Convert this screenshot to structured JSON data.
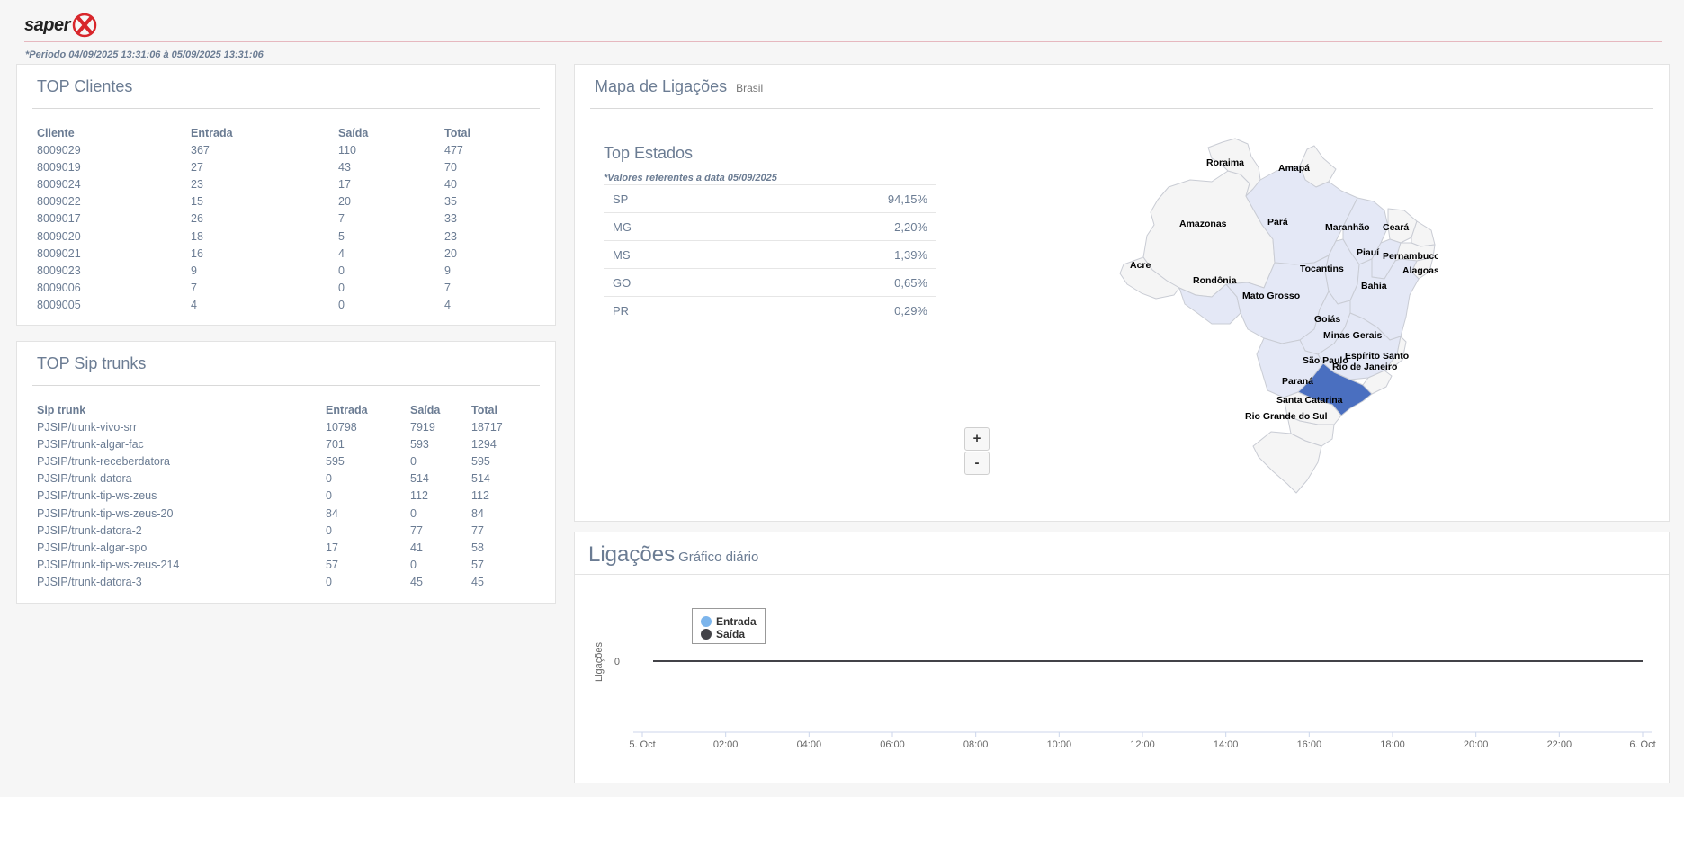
{
  "brand": {
    "name": "saper"
  },
  "period": "*Periodo 04/09/2025 13:31:06 à 05/09/2025 13:31:06",
  "top_clientes": {
    "title": "TOP Clientes",
    "headers": [
      "Cliente",
      "Entrada",
      "Saída",
      "Total"
    ],
    "rows": [
      [
        "8009029",
        "367",
        "110",
        "477"
      ],
      [
        "8009019",
        "27",
        "43",
        "70"
      ],
      [
        "8009024",
        "23",
        "17",
        "40"
      ],
      [
        "8009022",
        "15",
        "20",
        "35"
      ],
      [
        "8009017",
        "26",
        "7",
        "33"
      ],
      [
        "8009020",
        "18",
        "5",
        "23"
      ],
      [
        "8009021",
        "16",
        "4",
        "20"
      ],
      [
        "8009023",
        "9",
        "0",
        "9"
      ],
      [
        "8009006",
        "7",
        "0",
        "7"
      ],
      [
        "8009005",
        "4",
        "0",
        "4"
      ]
    ]
  },
  "top_sip": {
    "title": "TOP Sip trunks",
    "headers": [
      "Sip trunk",
      "Entrada",
      "Saída",
      "Total"
    ],
    "rows": [
      [
        "PJSIP/trunk-vivo-srr",
        "10798",
        "7919",
        "18717"
      ],
      [
        "PJSIP/trunk-algar-fac",
        "701",
        "593",
        "1294"
      ],
      [
        "PJSIP/trunk-receberdatora",
        "595",
        "0",
        "595"
      ],
      [
        "PJSIP/trunk-datora",
        "0",
        "514",
        "514"
      ],
      [
        "PJSIP/trunk-tip-ws-zeus",
        "0",
        "112",
        "112"
      ],
      [
        "PJSIP/trunk-tip-ws-zeus-20",
        "84",
        "0",
        "84"
      ],
      [
        "PJSIP/trunk-datora-2",
        "0",
        "77",
        "77"
      ],
      [
        "PJSIP/trunk-algar-spo",
        "17",
        "41",
        "58"
      ],
      [
        "PJSIP/trunk-tip-ws-zeus-214",
        "57",
        "0",
        "57"
      ],
      [
        "PJSIP/trunk-datora-3",
        "0",
        "45",
        "45"
      ]
    ]
  },
  "mapa": {
    "title": "Mapa de Ligações",
    "subtitle": "Brasil",
    "top_estados_title": "Top Estados",
    "note": "*Valores referentes a data 05/09/2025",
    "estados": [
      {
        "uf": "SP",
        "pct": "94,15%"
      },
      {
        "uf": "MG",
        "pct": "2,20%"
      },
      {
        "uf": "MS",
        "pct": "1,39%"
      },
      {
        "uf": "GO",
        "pct": "0,65%"
      },
      {
        "uf": "PR",
        "pct": "0,29%"
      }
    ],
    "zoom_in": "+",
    "zoom_out": "-",
    "labels": {
      "roraima": "Roraima",
      "amapa": "Amapá",
      "amazonas": "Amazonas",
      "para": "Pará",
      "maranhao": "Maranhão",
      "ceara": "Ceará",
      "piaui": "Piauí",
      "pernambuco": "Pernambuco",
      "alagoas": "Alagoas",
      "acre": "Acre",
      "rondonia": "Rondônia",
      "tocantins": "Tocantins",
      "bahia": "Bahia",
      "mato_grosso": "Mato Grosso",
      "goias": "Goiás",
      "minas_gerais": "Minas Gerais",
      "sao_paulo": "São Paulo",
      "espirito_santo": "Espírito Santo",
      "rio_de_janeiro": "Rio de Janeiro",
      "parana": "Paraná",
      "santa_catarina": "Santa Catarina",
      "rio_grande_do_sul": "Rio Grande do Sul"
    },
    "colors": {
      "highlight": "#4a6fc0",
      "light": "#e4e8f6",
      "none": "#f5f5f5",
      "border": "#c9ccd4"
    }
  },
  "ligacoes": {
    "title": "Ligações",
    "subtitle": "Gráfico diário"
  },
  "chart_data": {
    "type": "line",
    "ylabel": "Ligações",
    "y_ticks": [
      "0"
    ],
    "x_ticks": [
      "5. Oct",
      "02:00",
      "04:00",
      "06:00",
      "08:00",
      "10:00",
      "12:00",
      "14:00",
      "16:00",
      "18:00",
      "20:00",
      "22:00",
      "6. Oct"
    ],
    "series": [
      {
        "name": "Entrada",
        "color": "#7cb5ec",
        "values": [
          0,
          0,
          0,
          0,
          0,
          0,
          0,
          0,
          0,
          0,
          0,
          0,
          0
        ]
      },
      {
        "name": "Saída",
        "color": "#434348",
        "values": [
          0,
          0,
          0,
          0,
          0,
          0,
          0,
          0,
          0,
          0,
          0,
          0,
          0
        ]
      }
    ],
    "legend": "top-left"
  }
}
